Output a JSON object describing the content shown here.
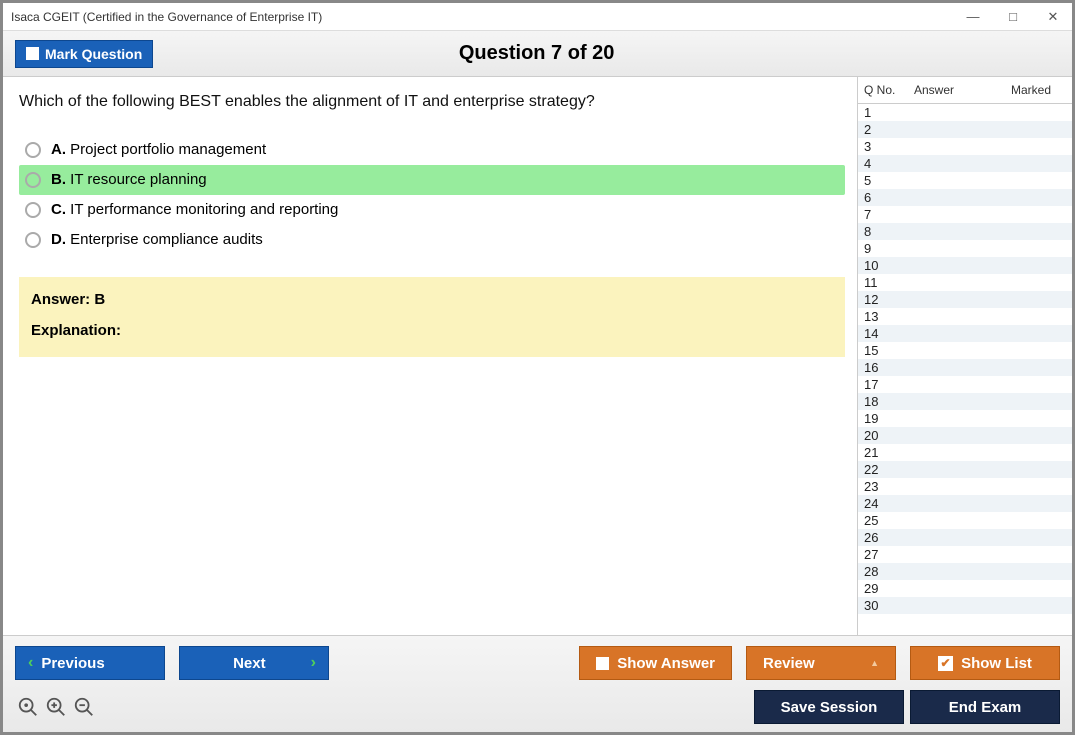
{
  "window": {
    "title": "Isaca CGEIT (Certified in the Governance of Enterprise IT)"
  },
  "topbar": {
    "mark_label": "Mark Question",
    "counter": "Question 7 of 20"
  },
  "question": {
    "text": "Which of the following BEST enables the alignment of IT and enterprise strategy?",
    "options": [
      {
        "letter": "A.",
        "text": "Project portfolio management",
        "selected": false
      },
      {
        "letter": "B.",
        "text": "IT resource planning",
        "selected": true
      },
      {
        "letter": "C.",
        "text": "IT performance monitoring and reporting",
        "selected": false
      },
      {
        "letter": "D.",
        "text": "Enterprise compliance audits",
        "selected": false
      }
    ]
  },
  "answer": {
    "label": "Answer: B",
    "exp_label": "Explanation:"
  },
  "list": {
    "headers": {
      "qno": "Q No.",
      "answer": "Answer",
      "marked": "Marked"
    },
    "rows": [
      1,
      2,
      3,
      4,
      5,
      6,
      7,
      8,
      9,
      10,
      11,
      12,
      13,
      14,
      15,
      16,
      17,
      18,
      19,
      20,
      21,
      22,
      23,
      24,
      25,
      26,
      27,
      28,
      29,
      30
    ]
  },
  "buttons": {
    "previous": "Previous",
    "next": "Next",
    "show_answer": "Show Answer",
    "review": "Review",
    "show_list": "Show List",
    "save_session": "Save Session",
    "end_exam": "End Exam"
  }
}
